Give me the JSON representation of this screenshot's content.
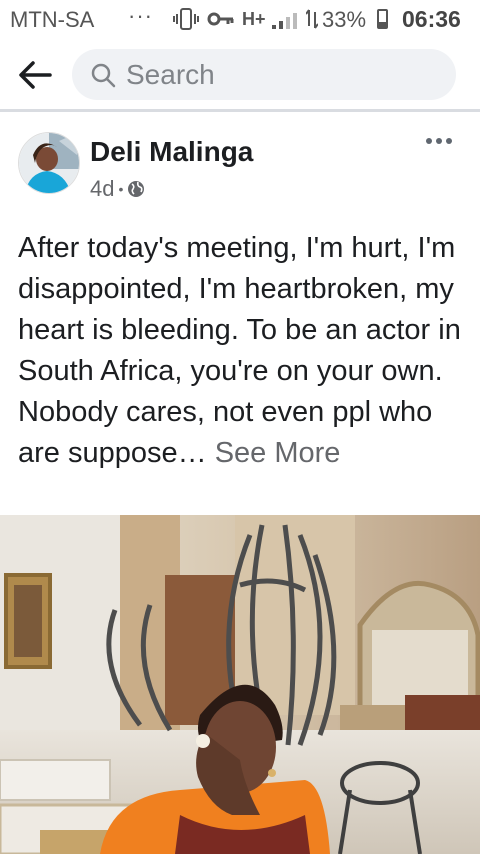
{
  "status_bar": {
    "carrier": "MTN-SA",
    "overflow": "···",
    "network_type": "H+",
    "battery_percent": "33%",
    "battery_level": 0.33,
    "time": "06:36",
    "icons": [
      "vibrate-icon",
      "key-icon",
      "signal-icon",
      "data-arrows-icon",
      "battery-icon"
    ]
  },
  "header": {
    "back_icon": "arrow-left-icon",
    "search_placeholder": "Search"
  },
  "post": {
    "author": "Deli Malinga",
    "age": "4d",
    "separator": "•",
    "privacy_icon": "globe-icon",
    "options_icon": "more-horizontal-icon",
    "text": "After today's meeting, I'm hurt, I'm disappointed, I'm heartbroken, my heart is bleeding. To be an actor in South Africa, you're on your own. Nobody cares, not even ppl who are suppose…",
    "see_more": "See More"
  },
  "colors": {
    "search_bg": "#f0f2f5",
    "text_primary": "#1c1e21",
    "text_secondary": "#65676b",
    "divider": "#d9dce1"
  }
}
